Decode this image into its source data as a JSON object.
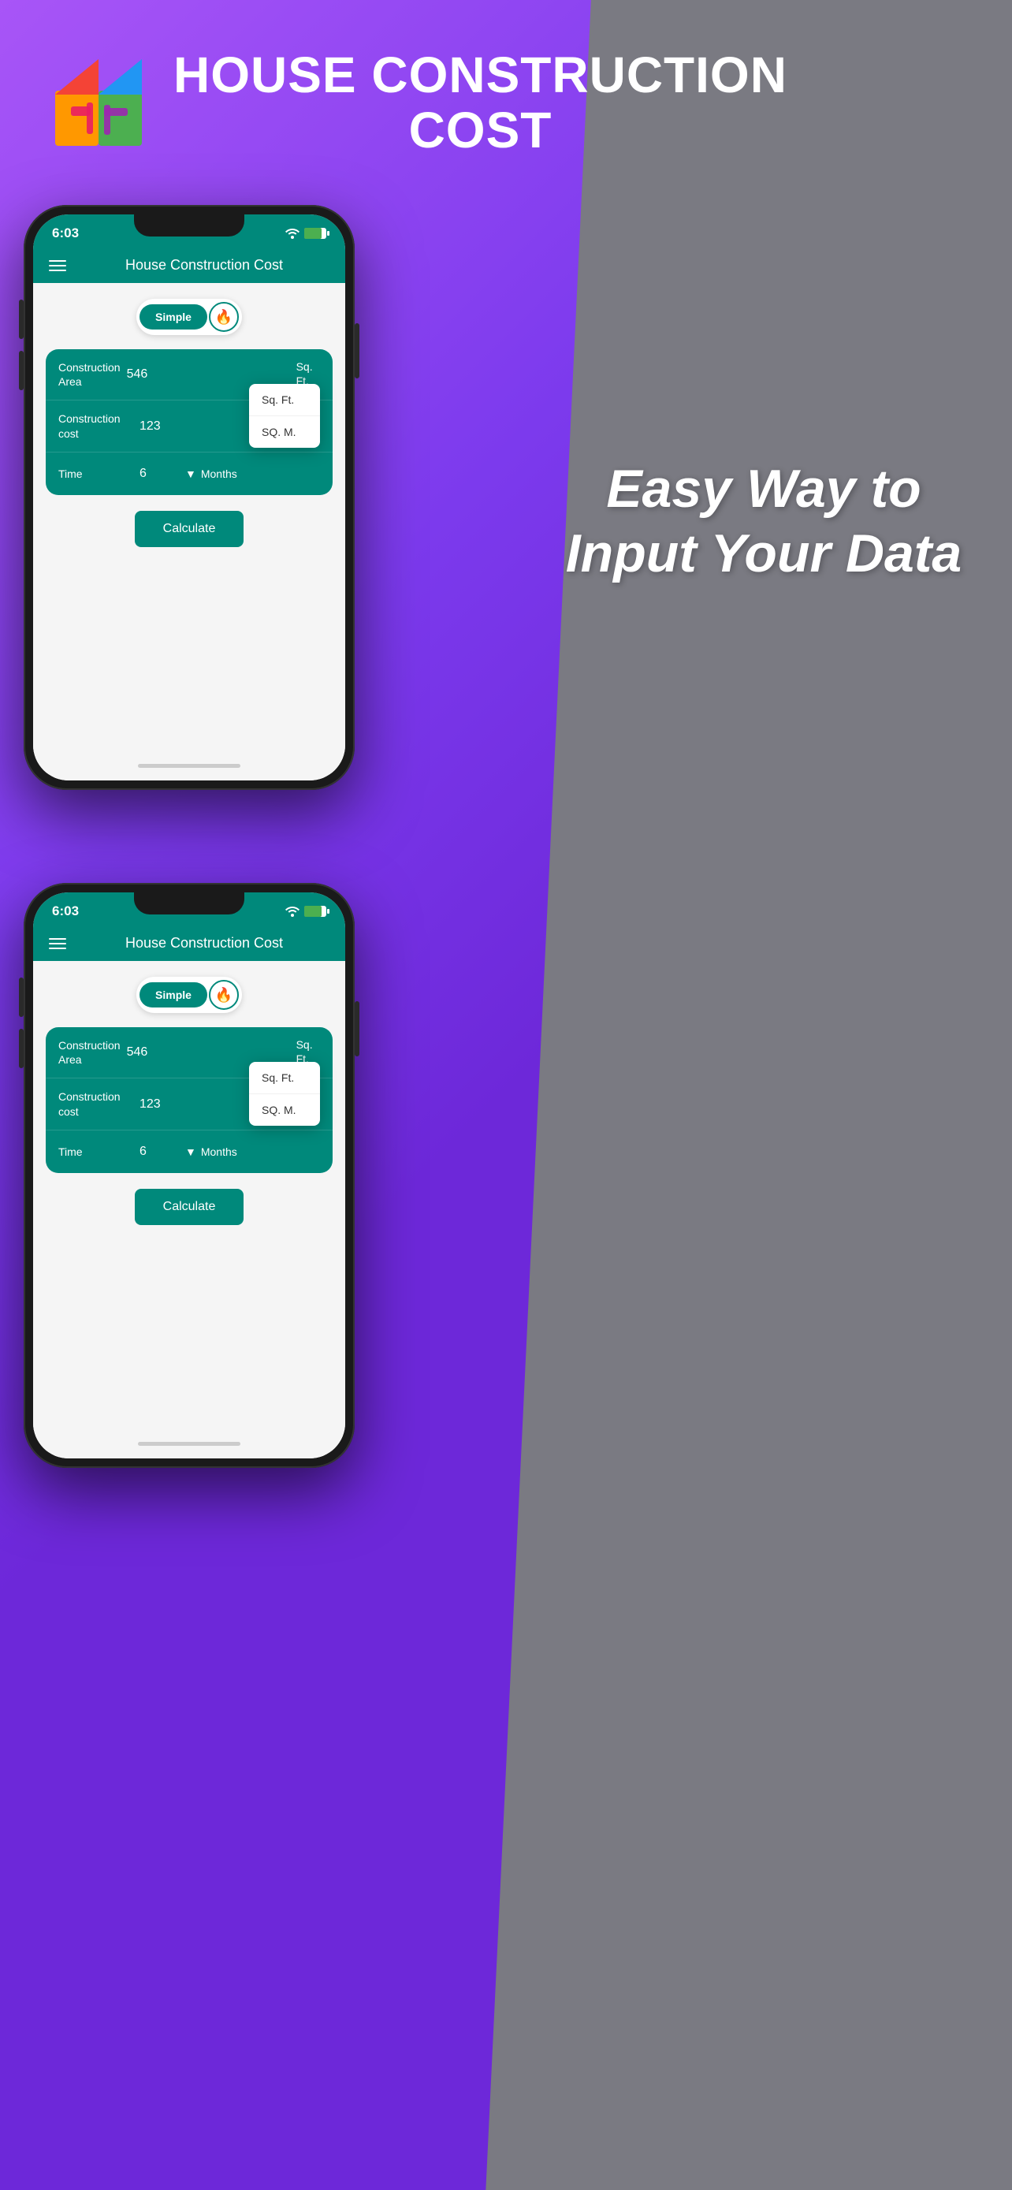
{
  "app": {
    "title_line1": "HOUSE CONSTRUCTION",
    "title_line2": "COST"
  },
  "header": {
    "status_time": "6:03",
    "app_title": "House Construction Cost"
  },
  "toggle": {
    "simple_label": "Simple",
    "fire_icon": "🔥"
  },
  "form": {
    "row1_label": "Construction Area",
    "row1_value": "546",
    "row1_unit": "Sq. Ft.",
    "row1_unit2": "SQ. M.",
    "row2_label": "Construction cost",
    "row2_value": "123",
    "row3_label": "Time",
    "row3_value": "6",
    "row3_unit": "Months"
  },
  "calculate_button": "Calculate",
  "tagline": "Easy Way to Input Your Data",
  "colors": {
    "teal": "#00897b",
    "bg_purple": "#7c3aed",
    "bg_gray": "#7a7a82"
  }
}
